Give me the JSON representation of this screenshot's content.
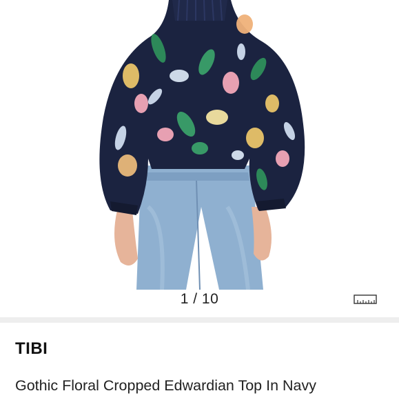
{
  "gallery": {
    "current": 1,
    "total": 10,
    "counter_text": "1 / 10",
    "size_guide_icon": "ruler-icon"
  },
  "product": {
    "brand": "TIBI",
    "title": "Gothic Floral Cropped Edwardian Top In Navy"
  },
  "colors": {
    "blouse": "#1b2340",
    "jeans": "#8fb0d0",
    "divider": "#eeeeee"
  }
}
